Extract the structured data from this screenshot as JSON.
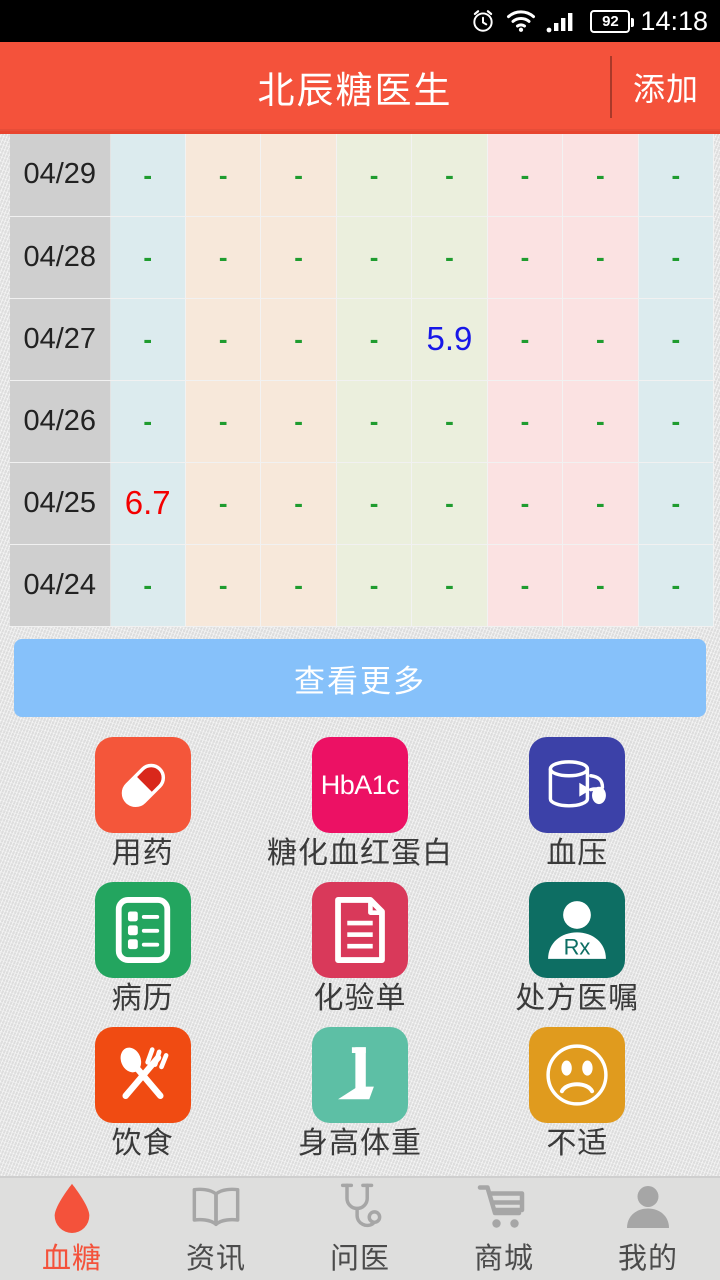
{
  "statusbar": {
    "alarm_icon": "alarm-clock-icon",
    "wifi_icon": "wifi-icon",
    "signal_icon": "cellular-signal-icon",
    "battery_level": "92",
    "time": "14:18"
  },
  "header": {
    "title": "北辰糖医生",
    "action_label": "添加",
    "bg_color": "#f4523b"
  },
  "table": {
    "rows": [
      {
        "date": "04/29",
        "cells": [
          {
            "text": "-",
            "state": "empty"
          },
          {
            "text": "-",
            "state": "empty"
          },
          {
            "text": "-",
            "state": "empty"
          },
          {
            "text": "-",
            "state": "empty"
          },
          {
            "text": "-",
            "state": "empty"
          },
          {
            "text": "-",
            "state": "empty"
          },
          {
            "text": "-",
            "state": "empty"
          },
          {
            "text": "-",
            "state": "empty"
          }
        ]
      },
      {
        "date": "04/28",
        "cells": [
          {
            "text": "-",
            "state": "empty"
          },
          {
            "text": "-",
            "state": "empty"
          },
          {
            "text": "-",
            "state": "empty"
          },
          {
            "text": "-",
            "state": "empty"
          },
          {
            "text": "-",
            "state": "empty"
          },
          {
            "text": "-",
            "state": "empty"
          },
          {
            "text": "-",
            "state": "empty"
          },
          {
            "text": "-",
            "state": "empty"
          }
        ]
      },
      {
        "date": "04/27",
        "cells": [
          {
            "text": "-",
            "state": "empty"
          },
          {
            "text": "-",
            "state": "empty"
          },
          {
            "text": "-",
            "state": "empty"
          },
          {
            "text": "-",
            "state": "empty"
          },
          {
            "text": "5.9",
            "state": "low"
          },
          {
            "text": "-",
            "state": "empty"
          },
          {
            "text": "-",
            "state": "empty"
          },
          {
            "text": "-",
            "state": "empty"
          }
        ]
      },
      {
        "date": "04/26",
        "cells": [
          {
            "text": "-",
            "state": "empty"
          },
          {
            "text": "-",
            "state": "empty"
          },
          {
            "text": "-",
            "state": "empty"
          },
          {
            "text": "-",
            "state": "empty"
          },
          {
            "text": "-",
            "state": "empty"
          },
          {
            "text": "-",
            "state": "empty"
          },
          {
            "text": "-",
            "state": "empty"
          },
          {
            "text": "-",
            "state": "empty"
          }
        ]
      },
      {
        "date": "04/25",
        "cells": [
          {
            "text": "6.7",
            "state": "high"
          },
          {
            "text": "-",
            "state": "empty"
          },
          {
            "text": "-",
            "state": "empty"
          },
          {
            "text": "-",
            "state": "empty"
          },
          {
            "text": "-",
            "state": "empty"
          },
          {
            "text": "-",
            "state": "empty"
          },
          {
            "text": "-",
            "state": "empty"
          },
          {
            "text": "-",
            "state": "empty"
          }
        ]
      },
      {
        "date": "04/24",
        "cells": [
          {
            "text": "-",
            "state": "empty"
          },
          {
            "text": "-",
            "state": "empty"
          },
          {
            "text": "-",
            "state": "empty"
          },
          {
            "text": "-",
            "state": "empty"
          },
          {
            "text": "-",
            "state": "empty"
          },
          {
            "text": "-",
            "state": "empty"
          },
          {
            "text": "-",
            "state": "empty"
          },
          {
            "text": "-",
            "state": "empty"
          }
        ]
      }
    ],
    "column_colors": [
      "#dcebee",
      "#f7e8da",
      "#f7e8da",
      "#ebefdd",
      "#ebefdd",
      "#fbe2e2",
      "#fbe2e2",
      "#dcebee"
    ],
    "date_col_color": "#cfcfcf"
  },
  "more_button": {
    "label": "查看更多",
    "bg_color": "#86c1fa"
  },
  "icon_grid": {
    "items": [
      {
        "label": "用药",
        "icon": "pill-capsule-icon",
        "bg": "#f4563a"
      },
      {
        "label": "糖化血红蛋白",
        "icon": "hba1c-icon",
        "bg": "#ec1164",
        "text": "HbA1c"
      },
      {
        "label": "血压",
        "icon": "blood-pressure-cuff-icon",
        "bg": "#3c41a8"
      },
      {
        "label": "病历",
        "icon": "medical-record-icon",
        "bg": "#23a55f"
      },
      {
        "label": "化验单",
        "icon": "lab-report-icon",
        "bg": "#d9395a"
      },
      {
        "label": "处方医嘱",
        "icon": "prescription-rx-icon",
        "bg": "#0d6e63",
        "text": "Rx"
      },
      {
        "label": "饮食",
        "icon": "spoon-fork-icon",
        "bg": "#f04b12"
      },
      {
        "label": "身高体重",
        "icon": "height-weight-scale-icon",
        "bg": "#5dbfa5"
      },
      {
        "label": "不适",
        "icon": "sad-face-icon",
        "bg": "#e09b1e"
      }
    ]
  },
  "tabbar": {
    "active_color": "#f4523b",
    "inactive_color": "#4b4b4b",
    "tabs": [
      {
        "label": "血糖",
        "icon": "blood-drop-icon",
        "active": true
      },
      {
        "label": "资讯",
        "icon": "book-icon",
        "active": false
      },
      {
        "label": "问医",
        "icon": "stethoscope-icon",
        "active": false
      },
      {
        "label": "商城",
        "icon": "shopping-cart-icon",
        "active": false
      },
      {
        "label": "我的",
        "icon": "person-icon",
        "active": false
      }
    ]
  }
}
